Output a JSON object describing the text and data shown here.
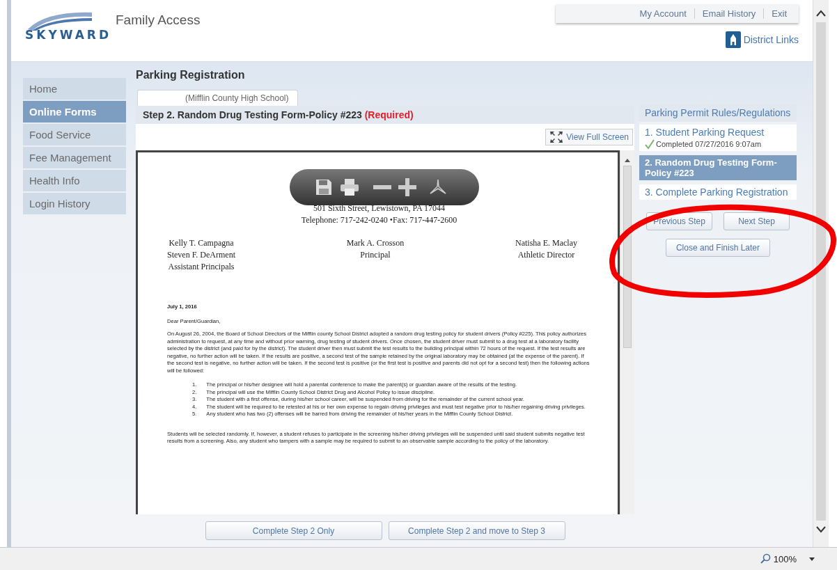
{
  "header": {
    "logo": "SKYWARD",
    "app_title": "Family Access",
    "links": [
      "My Account",
      "Email History",
      "Exit"
    ],
    "district_links": "District Links"
  },
  "sidebar": {
    "items": [
      {
        "label": "Home",
        "selected": false
      },
      {
        "label": "Online Forms",
        "selected": true
      },
      {
        "label": "Food Service",
        "selected": false
      },
      {
        "label": "Fee Management",
        "selected": false
      },
      {
        "label": "Health Info",
        "selected": false
      },
      {
        "label": "Login History",
        "selected": false
      }
    ]
  },
  "page": {
    "title": "Parking Registration",
    "tabs": [
      {
        "label": "(Mifflin County High School)",
        "selected": true
      }
    ],
    "step_title": "Step 2. Random Drug Testing Form-Policy #223",
    "step_required": "(Required)",
    "view_full_screen": "View Full Screen",
    "document": {
      "address": "501 Sixth Street, Lewistown, PA 17044",
      "telephone": "Telephone: 717-242-0240 •Fax: 717-447-2600",
      "staff": [
        {
          "lines": [
            "Kelly T. Campagna",
            "Steven F. DeArment",
            "Assistant Principals"
          ]
        },
        {
          "lines": [
            "Mark A. Crosson",
            "Principal"
          ]
        },
        {
          "lines": [
            "Natisha E. Maclay",
            "Athletic Director"
          ]
        }
      ],
      "date": "July 1, 2016",
      "salutation": "Dear Parent/Guardian,",
      "paragraph": "On August 26, 2004, the Board of School Directors of the Mifflin county School District adopted a random drug testing policy for student drivers (Policy #225).  This policy authorizes administration to request, at any time and without prior warning, drug testing of student drivers. Once chosen, the student driver must submit to a drug test at a laboratory facility selected by the district (and paid for by the district).  The student driver then must submit the test results to the building principal within 72 hours of the request.  If the test results are negative, no further action will be taken. If the results are positive, a second test of the sample retained by the original laboratory may be obtained (at the expense of the parent).  If the second test is negative, no further action will be taken.  If the second test is positive (or the first test is positive and parents did not opt for a second test) then the following actions will be followed:",
      "list": [
        {
          "number": "1.",
          "text": "The principal or his/her designee will hold a parental conference to make the parent(s) or guardian aware of the results of the testing."
        },
        {
          "number": "2.",
          "text": "The principal will use the Mifflin County School District Drug and Alcohol Policy to issue discipline."
        },
        {
          "number": "3.",
          "text": "The student with a first offense, during his/her school career, will be suspended from driving for the remainder of the current school year."
        },
        {
          "number": "4.",
          "text": "The student will be required to be retested at his or her own expense to regain driving privileges and must test negative prior to his/her regaining driving privileges."
        },
        {
          "number": "5.",
          "text": "Any student who has two (2) offenses will be barred from driving the remainder of his/her years in the Mifflin County School District."
        }
      ],
      "closing": "Students will be selected randomly.  If, however, a student refuses to participate in the screening his/her driving privileges will be suspended until said student submits negative test results from a screening. Also, any student who tampers with a sample may be required to submit to an observable sample according to the policy of the laboratory."
    },
    "buttons": [
      "Complete Step 2 Only",
      "Complete Step 2 and move to Step 3"
    ]
  },
  "steps_panel": {
    "title": "Parking Permit Rules/Regulations",
    "steps": [
      {
        "label": "1. Student Parking Request",
        "status": "Completed 07/27/2016 9:07am",
        "completed": true,
        "selected": false
      },
      {
        "label": "2. Random Drug Testing Form-Policy #223",
        "completed": false,
        "selected": true
      },
      {
        "label": "3. Complete Parking Registration",
        "completed": false,
        "selected": false
      }
    ],
    "buttons": [
      "Previous Step",
      "Next Step",
      "Close and Finish Later"
    ]
  },
  "status_bar": {
    "zoom": "100%"
  }
}
